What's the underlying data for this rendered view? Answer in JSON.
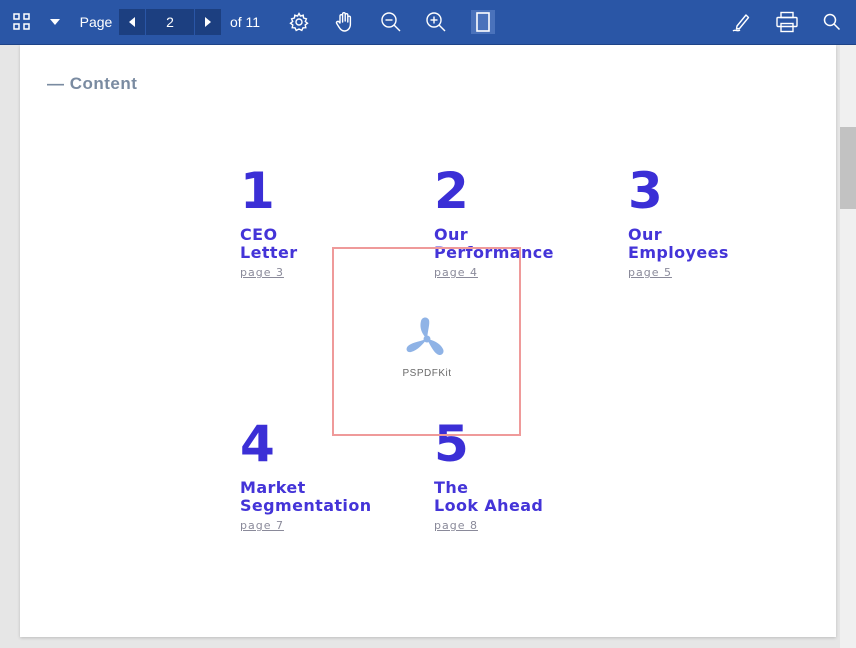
{
  "toolbar": {
    "page_label": "Page",
    "current_page": "2",
    "page_total_label": "of 11"
  },
  "document": {
    "heading": "— Content",
    "items": [
      {
        "number": "1",
        "title_line1": "CEO",
        "title_line2": "Letter",
        "link": "page 3"
      },
      {
        "number": "2",
        "title_line1": "Our",
        "title_line2": "Performance",
        "link": "page 4"
      },
      {
        "number": "3",
        "title_line1": "Our",
        "title_line2": "Employees",
        "link": "page 5"
      },
      {
        "number": "4",
        "title_line1": "Market",
        "title_line2": "Segmentation",
        "link": "page 7"
      },
      {
        "number": "5",
        "title_line1": "The",
        "title_line2": "Look Ahead",
        "link": "page 8"
      }
    ],
    "watermark_text": "PSPDFKit"
  },
  "icons": {
    "thumbnails": "grid-icon",
    "dropdown": "caret-down-icon",
    "prev": "triangle-left-icon",
    "next": "triangle-right-icon",
    "settings": "gear-icon",
    "pan": "hand-icon",
    "zoom_out": "zoom-out-icon",
    "zoom_in": "zoom-in-icon",
    "fit": "fit-page-icon",
    "annotate": "pen-icon",
    "print": "printer-icon",
    "search": "search-icon"
  },
  "colors": {
    "toolbar": "#2a56a6",
    "accent_text": "#3b2fd6",
    "selection": "#ef9a9a"
  }
}
